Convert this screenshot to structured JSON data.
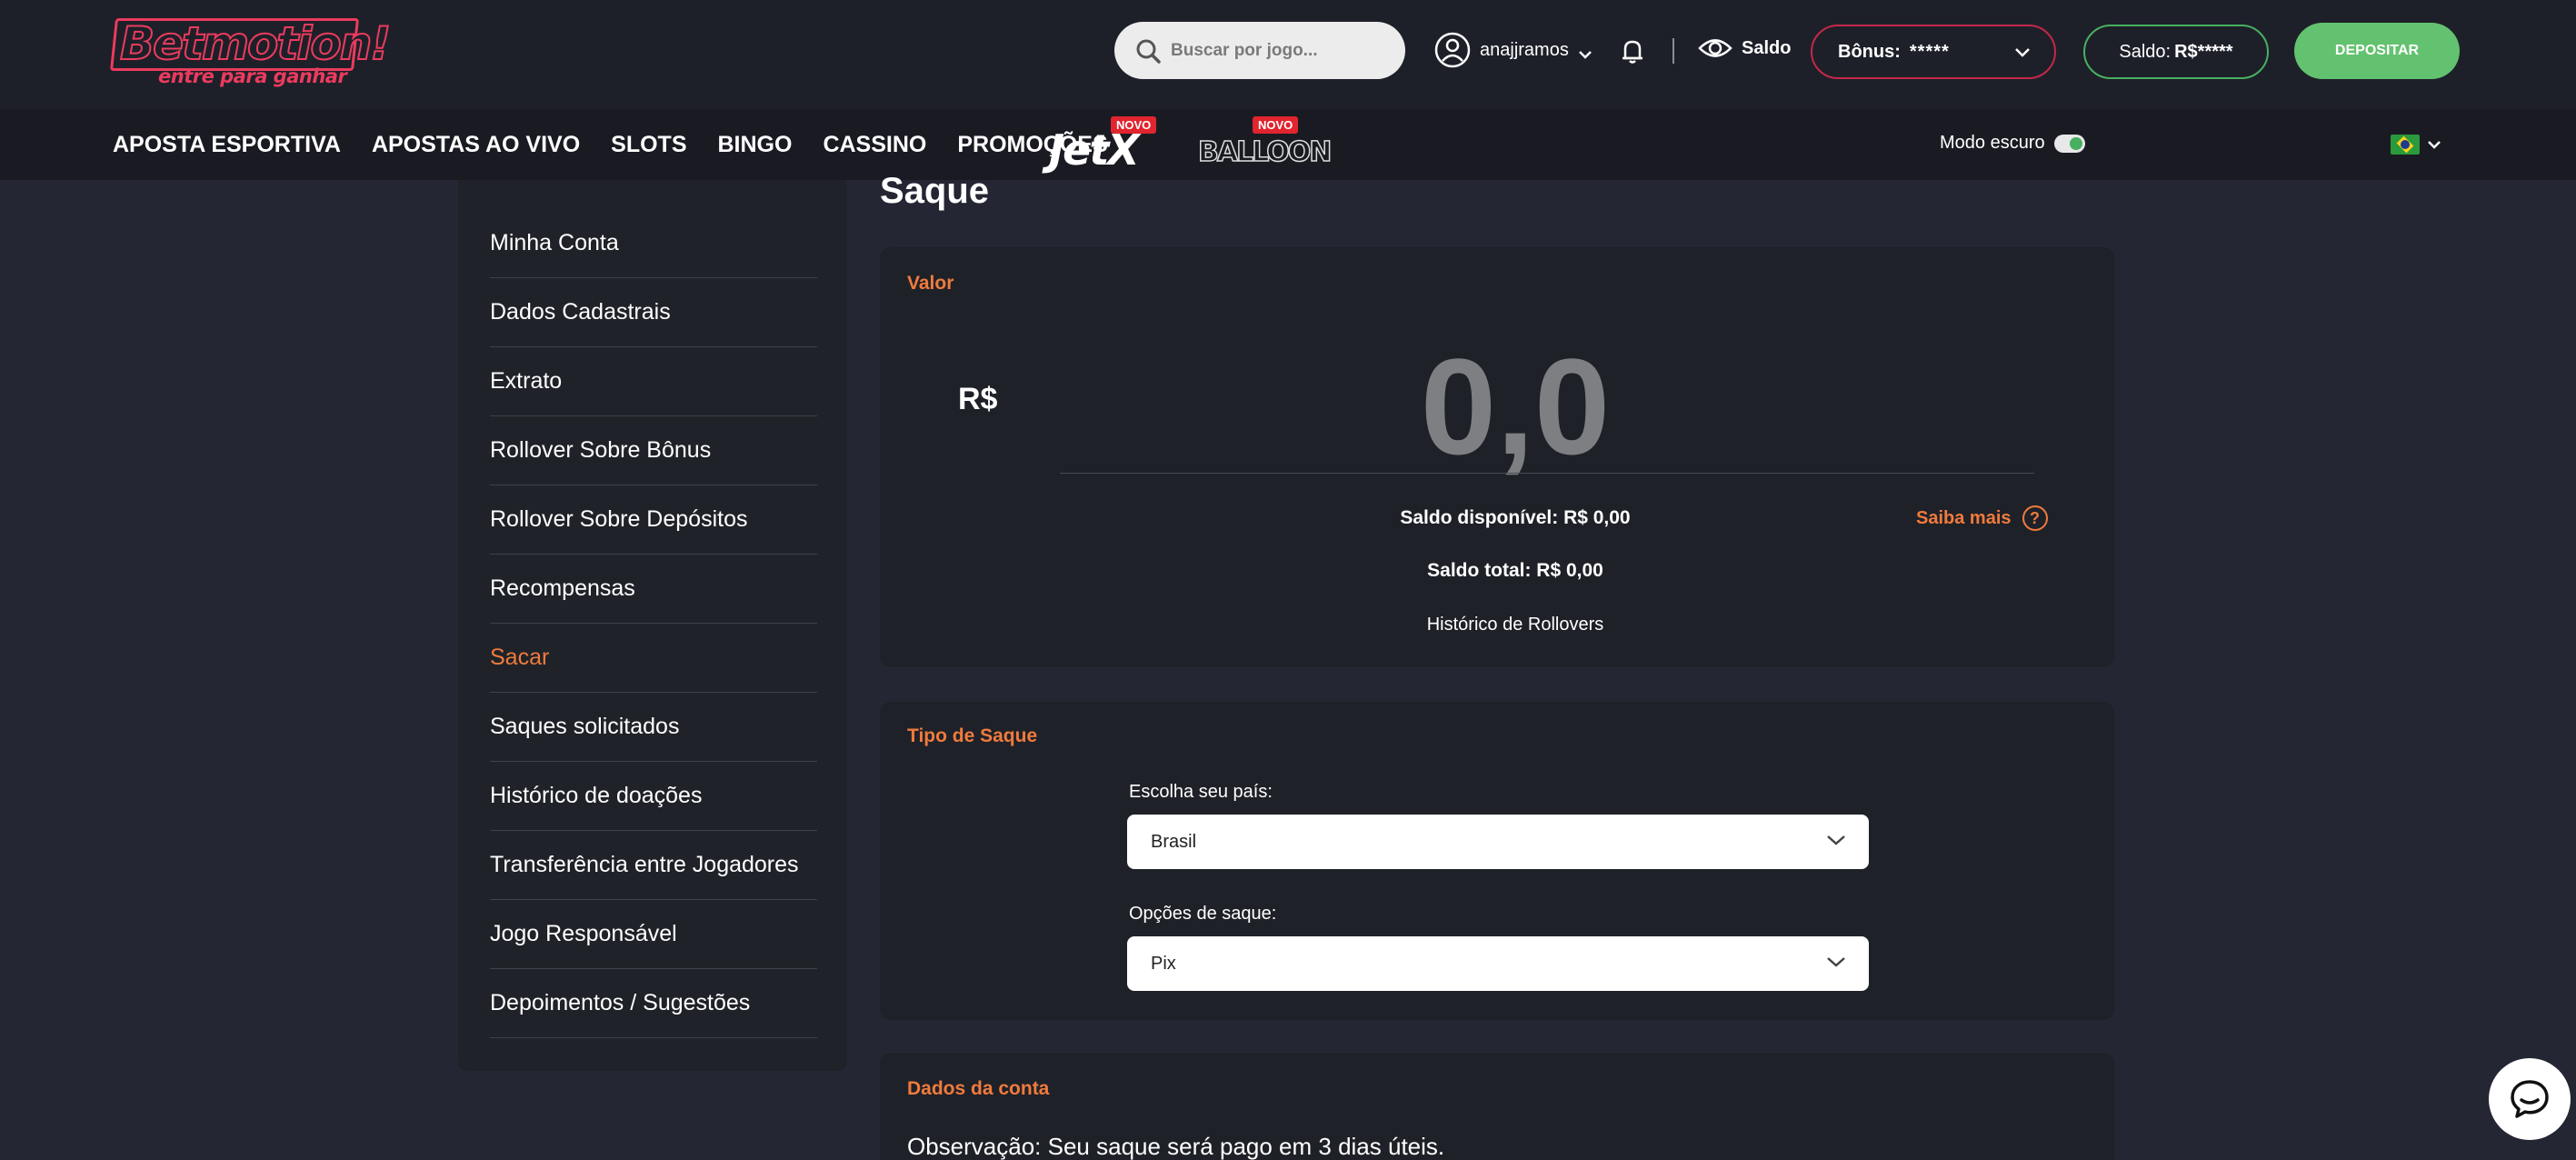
{
  "brand": {
    "logo_text": "Betmotion!",
    "tagline": "entre para ganhar",
    "accent_color": "#ec3b5e"
  },
  "header": {
    "search_placeholder": "Buscar por jogo...",
    "username": "anajjramos",
    "saldo_toggle_label": "Saldo",
    "bonus_label": "Bônus:",
    "bonus_value": "*****",
    "saldo_label": "Saldo:",
    "saldo_value": "R$*****",
    "deposit_label": "DEPOSITAR",
    "deposit_color": "#63c26f"
  },
  "nav": {
    "items": [
      "APOSTA ESPORTIVA",
      "APOSTAS AO VIVO",
      "SLOTS",
      "BINGO",
      "CASSINO",
      "PROMOÇÕES"
    ],
    "games": [
      {
        "name": "JetX",
        "badge": "NOVO"
      },
      {
        "name": "BALLOON",
        "badge": "NOVO"
      }
    ],
    "dark_mode_label": "Modo escuro",
    "dark_mode_on": true,
    "language_flag": "brazil-flag-icon"
  },
  "sidebar": {
    "items": [
      {
        "label": "Minha Conta",
        "active": false
      },
      {
        "label": "Dados Cadastrais",
        "active": false
      },
      {
        "label": "Extrato",
        "active": false
      },
      {
        "label": "Rollover Sobre Bônus",
        "active": false
      },
      {
        "label": "Rollover Sobre Depósitos",
        "active": false
      },
      {
        "label": "Recompensas",
        "active": false
      },
      {
        "label": "Sacar",
        "active": true
      },
      {
        "label": "Saques solicitados",
        "active": false
      },
      {
        "label": "Histórico de doações",
        "active": false
      },
      {
        "label": "Transferência entre Jogadores",
        "active": false
      },
      {
        "label": "Jogo Responsável",
        "active": false
      },
      {
        "label": "Depoimentos / Sugestões",
        "active": false
      }
    ],
    "active_color": "#ef7b3d"
  },
  "main": {
    "title": "Saque",
    "valor_card": {
      "title": "Valor",
      "currency": "R$",
      "amount": "0,0",
      "saldo_disponivel": "Saldo disponível: R$ 0,00",
      "saldo_total": "Saldo total: R$ 0,00",
      "saiba_mais": "Saiba mais",
      "historico_rollovers": "Histórico de Rollovers"
    },
    "tipo_card": {
      "title": "Tipo de Saque",
      "country_label": "Escolha seu país:",
      "country_value": "Brasil",
      "option_label": "Opções de saque:",
      "option_value": "Pix"
    },
    "conta_card": {
      "title": "Dados da conta",
      "observacao": "Observação: Seu saque será pago em 3 dias úteis."
    }
  }
}
